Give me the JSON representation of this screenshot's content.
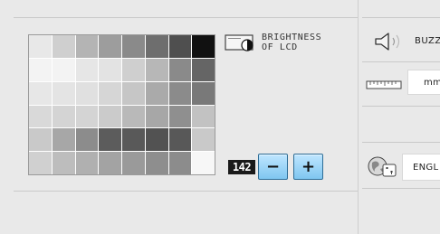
{
  "brightness": {
    "label": "BRIGHTNESS\nOF LCD",
    "value": "142",
    "minus_label": "−",
    "plus_label": "+"
  },
  "buzzer": {
    "label": "BUZZ"
  },
  "units": {
    "value": "mm"
  },
  "language": {
    "value": "ENGL"
  },
  "palette": [
    [
      "#e8e8e8",
      "#cfcfcf",
      "#b4b4b4",
      "#9d9d9d",
      "#8a8a8a",
      "#6e6e6e",
      "#4f4f4f",
      "#111111"
    ],
    [
      "#f3f3f3",
      "#f3f3f3",
      "#e6e6e6",
      "#e3e3e3",
      "#cfcfcf",
      "#b7b7b7",
      "#8a8a8a",
      "#656565"
    ],
    [
      "#e7e7e7",
      "#e4e4e4",
      "#e0e0e0",
      "#d6d6d6",
      "#c6c6c6",
      "#aaaaaa",
      "#8b8b8b",
      "#797979"
    ],
    [
      "#d9d9d9",
      "#d4d4d4",
      "#d4d4d4",
      "#cbcbcb",
      "#b9b9b9",
      "#a7a7a7",
      "#8f8f8f",
      "#c2c2c2"
    ],
    [
      "#c9c9c9",
      "#a7a7a7",
      "#8c8c8c",
      "#5c5c5c",
      "#595959",
      "#525252",
      "#585858",
      "#c9c9c9"
    ],
    [
      "#d0d0d0",
      "#bdbdbd",
      "#b0b0b0",
      "#a3a3a3",
      "#9a9a9a",
      "#8e8e8e",
      "#8c8c8c",
      "#f7f7f7"
    ]
  ]
}
